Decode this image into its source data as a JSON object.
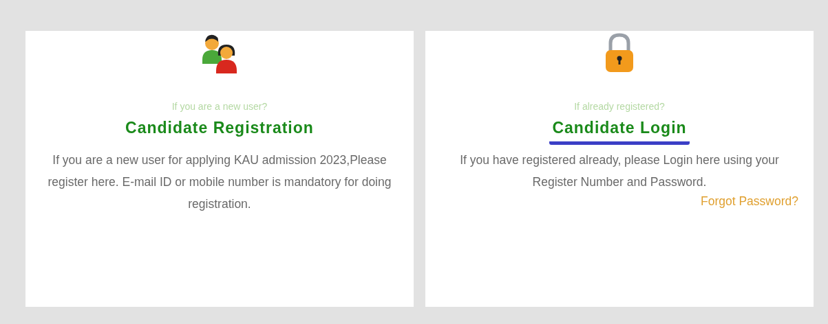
{
  "cards": [
    {
      "kind": "users",
      "prompt": "If you are a new user?",
      "title": "Candidate Registration",
      "underlined": false,
      "description": "If you are a new user for applying KAU admission 2023,Please register here. E-mail ID or mobile number is mandatory for doing registration."
    },
    {
      "kind": "lock",
      "prompt": "If already registered?",
      "title": "Candidate Login",
      "underlined": true,
      "description": "If you have registered already, please Login here using your Register Number and Password.",
      "link": "Forgot Password?"
    }
  ]
}
